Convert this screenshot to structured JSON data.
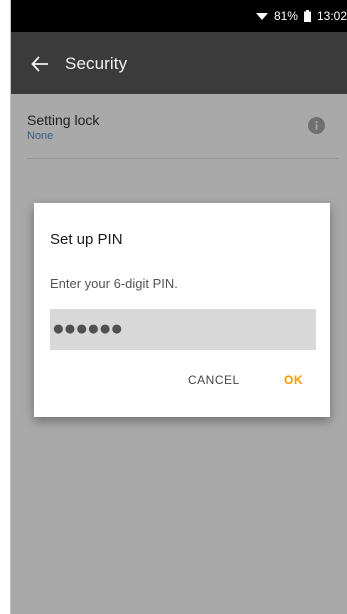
{
  "status_bar": {
    "battery_percent": "81%",
    "time": "13:02"
  },
  "app_bar": {
    "title": "Security"
  },
  "setting": {
    "title": "Setting lock",
    "value": "None"
  },
  "dialog": {
    "title": "Set up PIN",
    "message": "Enter your 6-digit PIN.",
    "pin_value": "●●●●●●",
    "cancel_label": "CANCEL",
    "ok_label": "OK"
  },
  "colors": {
    "accent": "#f29a00",
    "app_bar": "#3b3b3b",
    "scrim": "#a9a9a9",
    "dialog_bg": "#ffffff"
  },
  "icons": {
    "back": "back-arrow-icon",
    "info": "info-icon",
    "wifi": "wifi-icon",
    "battery": "battery-icon"
  }
}
